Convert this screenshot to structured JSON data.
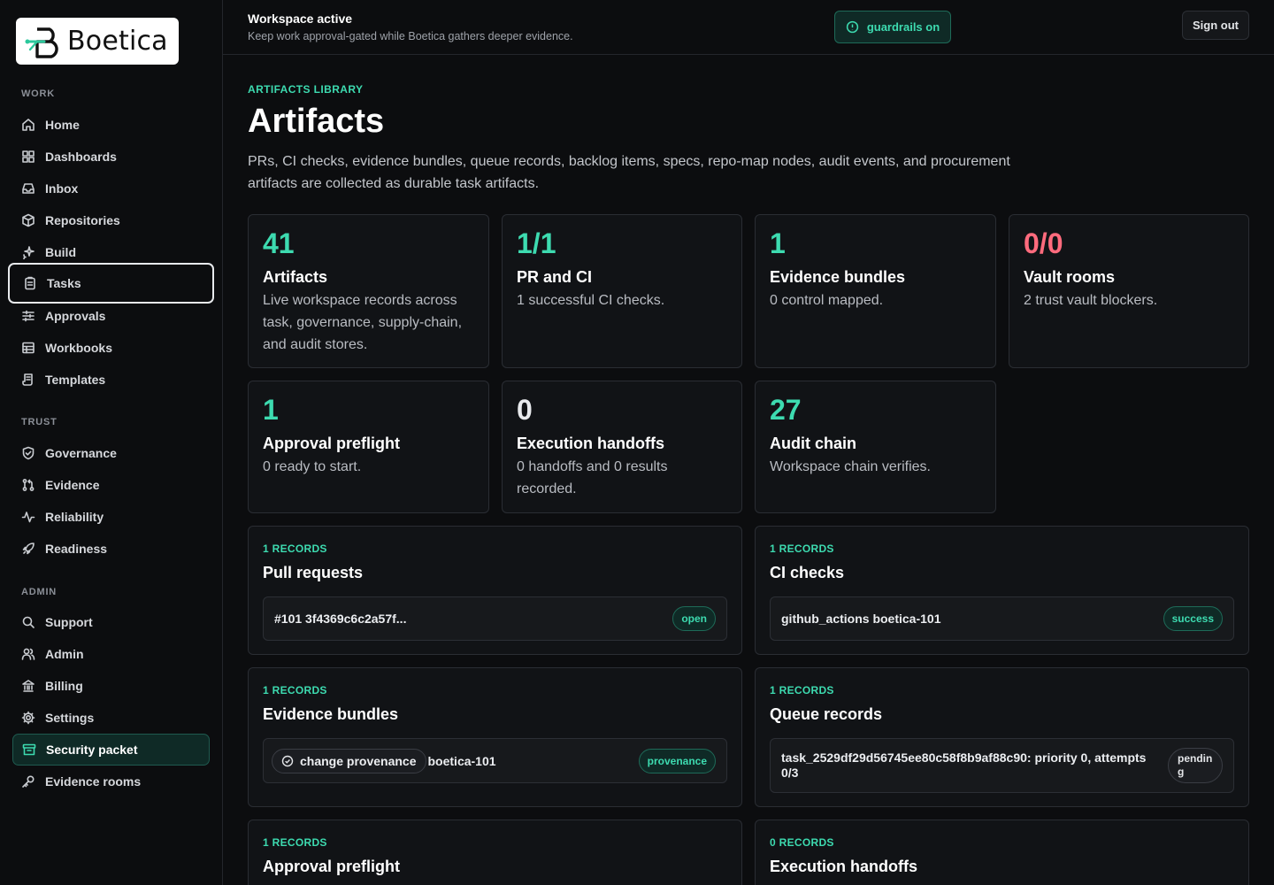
{
  "brand": {
    "name": "Boetica"
  },
  "sidebar": {
    "sections": {
      "work": "WORK",
      "trust": "TRUST",
      "admin": "ADMIN"
    },
    "items": {
      "home": "Home",
      "dashboards": "Dashboards",
      "inbox": "Inbox",
      "repositories": "Repositories",
      "build": "Build",
      "tasks": "Tasks",
      "approvals": "Approvals",
      "workbooks": "Workbooks",
      "templates": "Templates",
      "governance": "Governance",
      "evidence": "Evidence",
      "reliability": "Reliability",
      "readiness": "Readiness",
      "support": "Support",
      "admin": "Admin",
      "billing": "Billing",
      "settings": "Settings",
      "security_packet": "Security packet",
      "evidence_rooms": "Evidence rooms"
    }
  },
  "topbar": {
    "title": "Workspace active",
    "subtitle": "Keep work approval-gated while Boetica gathers deeper evidence.",
    "guardrails_label": "guardrails on",
    "signout_label": "Sign out"
  },
  "header": {
    "eyebrow": "ARTIFACTS LIBRARY",
    "title": "Artifacts",
    "description": "PRs, CI checks, evidence bundles, queue records, backlog items, specs, repo-map nodes, audit events, and procurement artifacts are collected as durable task artifacts."
  },
  "stats": [
    {
      "value": "41",
      "label": "Artifacts",
      "desc": "Live workspace records across task, governance, supply-chain, and audit stores."
    },
    {
      "value": "1/1",
      "label": "PR and CI",
      "desc": "1 successful CI checks."
    },
    {
      "value": "1",
      "label": "Evidence bundles",
      "desc": "0 control mapped."
    },
    {
      "value": "0/0",
      "label": "Vault rooms",
      "desc": "2 trust vault blockers."
    },
    {
      "value": "1",
      "label": "Approval preflight",
      "desc": "0 ready to start."
    },
    {
      "value": "0",
      "label": "Execution handoffs",
      "desc": "0 handoffs and 0 results recorded."
    },
    {
      "value": "27",
      "label": "Audit chain",
      "desc": "Workspace chain verifies."
    }
  ],
  "records": {
    "pull_requests": {
      "count": "1 RECORDS",
      "title": "Pull requests",
      "row": "#101 3f4369c6c2a57f...",
      "badge": "open"
    },
    "ci_checks": {
      "count": "1 RECORDS",
      "title": "CI checks",
      "row": "github_actions boetica-101",
      "badge": "success"
    },
    "evidence_bundles": {
      "count": "1 RECORDS",
      "title": "Evidence bundles",
      "chip": "change provenance",
      "row": "boetica-101",
      "badge": "provenance"
    },
    "queue_records": {
      "count": "1 RECORDS",
      "title": "Queue records",
      "row": "task_2529df29d56745ee80c58f8b9af88c90: priority 0, attempts 0/3",
      "badge_line1": "pendin",
      "badge_line2": "g"
    },
    "approval_preflight": {
      "count": "1 RECORDS",
      "title": "Approval preflight"
    },
    "execution_handoffs": {
      "count": "0 RECORDS",
      "title": "Execution handoffs"
    }
  },
  "colors": {
    "accent": "#3ddbb0",
    "danger": "#ff6b7d",
    "background": "#0c0d0f",
    "card": "#111316"
  }
}
